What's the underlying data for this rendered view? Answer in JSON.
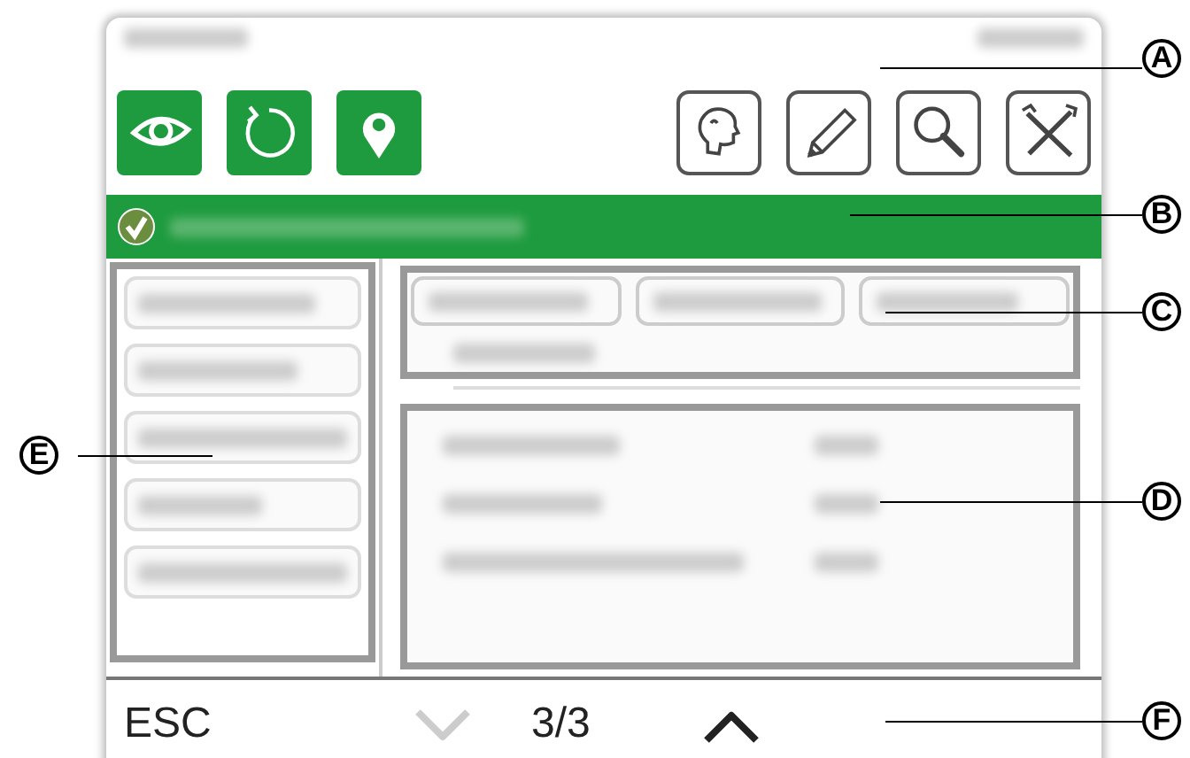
{
  "toolbar": {
    "buttons": [
      {
        "kind": "eye",
        "selected": true
      },
      {
        "kind": "refresh",
        "selected": true
      },
      {
        "kind": "pin",
        "selected": true
      },
      {
        "kind": "head",
        "selected": false
      },
      {
        "kind": "pencil",
        "selected": false
      },
      {
        "kind": "search",
        "selected": false
      },
      {
        "kind": "tools",
        "selected": false
      }
    ]
  },
  "status_bar": {
    "ok": true
  },
  "footer": {
    "esc": "ESC",
    "page": "3/3",
    "down_disabled": true,
    "up_disabled": false
  },
  "callouts": [
    {
      "label": "A"
    },
    {
      "label": "B"
    },
    {
      "label": "C"
    },
    {
      "label": "D"
    },
    {
      "label": "E"
    },
    {
      "label": "F"
    }
  ]
}
